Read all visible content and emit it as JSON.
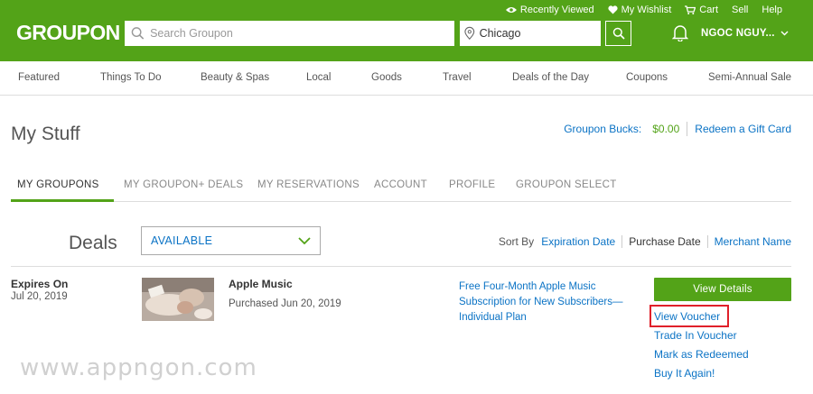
{
  "header": {
    "logo": "GROUPON",
    "top_links": {
      "recently_viewed": "Recently Viewed",
      "wishlist": "My Wishlist",
      "cart": "Cart",
      "sell": "Sell",
      "help": "Help"
    },
    "search": {
      "placeholder": "Search Groupon",
      "value": ""
    },
    "location": {
      "value": "Chicago"
    },
    "user_name": "NGOC NGUY...",
    "brand_color": "#53a318"
  },
  "category_nav": [
    "Featured",
    "Things To Do",
    "Beauty & Spas",
    "Local",
    "Goods",
    "Travel",
    "Deals of the Day",
    "Coupons",
    "Semi-Annual Sale"
  ],
  "page": {
    "title": "My Stuff",
    "bucks_label": "Groupon Bucks:",
    "bucks_amount": "$0.00",
    "redeem_link": "Redeem a Gift Card"
  },
  "tabs": [
    {
      "label": "MY GROUPONS",
      "active": true
    },
    {
      "label": "MY GROUPON+ DEALS",
      "active": false
    },
    {
      "label": "MY RESERVATIONS",
      "active": false
    },
    {
      "label": "ACCOUNT",
      "active": false
    },
    {
      "label": "PROFILE",
      "active": false
    },
    {
      "label": "GROUPON SELECT",
      "active": false
    }
  ],
  "deals": {
    "heading": "Deals",
    "status_filter": "AVAILABLE",
    "sort_label": "Sort By",
    "sort_options": [
      {
        "label": "Expiration Date",
        "selected": false
      },
      {
        "label": "Purchase Date",
        "selected": true
      },
      {
        "label": "Merchant Name",
        "selected": false
      }
    ],
    "items": [
      {
        "expires_label": "Expires On",
        "expires_date": "Jul 20, 2019",
        "merchant": "Apple Music",
        "purchased": "Purchased Jun 20, 2019",
        "title_lines": [
          "Free Four-Month Apple Music",
          "Subscription for New Subscribers—",
          "Individual Plan"
        ],
        "view_details": "View Details",
        "view_voucher": "View Voucher",
        "trade_in": "Trade In Voucher",
        "mark_redeemed": "Mark as Redeemed",
        "buy_again": "Buy It Again!"
      }
    ]
  },
  "watermark": "www.appngon.com",
  "colors": {
    "link": "#0b73c5",
    "highlight": "#e0202a"
  }
}
